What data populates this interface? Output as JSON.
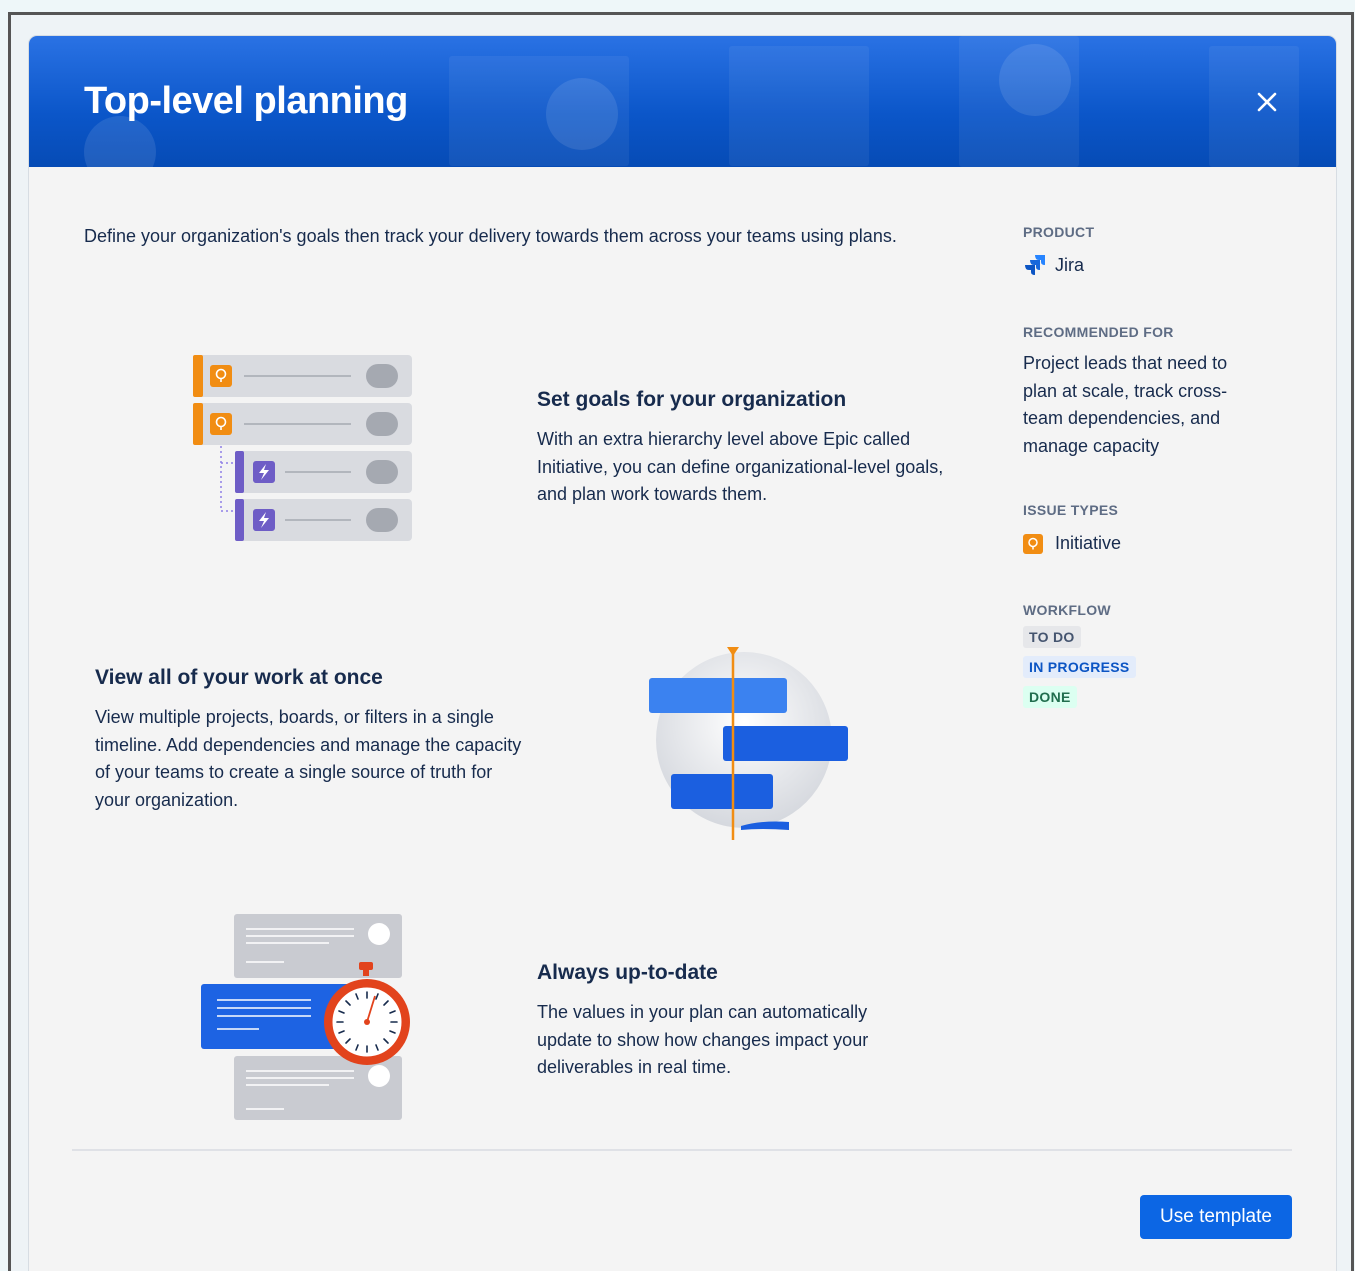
{
  "modal": {
    "title": "Top-level planning",
    "close_icon": "close-icon",
    "intro": "Define your organization's goals then track your delivery towards them across your teams using plans."
  },
  "features": [
    {
      "heading": "Set goals for your organization",
      "body": "With an extra hierarchy level above Epic called Initiative, you can define organizational-level goals, and plan work towards them."
    },
    {
      "heading": "View all of your work at once",
      "body": "View multiple projects, boards, or filters in a single timeline. Add dependencies and manage the capacity of your teams to create a single source of truth for your organization."
    },
    {
      "heading": "Always up-to-date",
      "body": "The values in your plan can automatically update to show how changes impact your deliverables in real time."
    }
  ],
  "sidebar": {
    "product_label": "PRODUCT",
    "product_value": "Jira",
    "product_icon": "jira-logo-icon",
    "recommended_label": "RECOMMENDED FOR",
    "recommended_value": "Project leads that need to plan at scale, track cross-team dependencies, and manage capacity",
    "issue_types_label": "ISSUE TYPES",
    "issue_types": [
      {
        "label": "Initiative",
        "icon": "initiative-icon",
        "color": "#f18d13"
      }
    ],
    "workflow_label": "WORKFLOW",
    "workflow": [
      {
        "label": "TO DO",
        "bg": "#e6e7ea",
        "fg": "#44546f"
      },
      {
        "label": "IN PROGRESS",
        "bg": "#e3ecfb",
        "fg": "#0c55c4"
      },
      {
        "label": "DONE",
        "bg": "#dcfff1",
        "fg": "#216e4e"
      }
    ]
  },
  "footer": {
    "use_template_label": "Use template"
  },
  "colors": {
    "brand": "#0c66e4",
    "initiative": "#f18d13",
    "epic": "#6e5dc6",
    "timeline_marker": "#f18d13"
  }
}
